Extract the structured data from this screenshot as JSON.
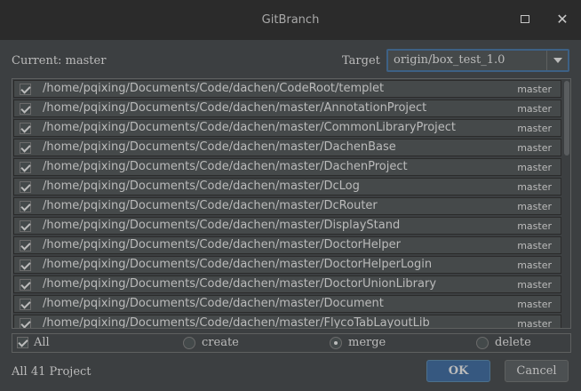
{
  "window": {
    "title": "GitBranch"
  },
  "header": {
    "current_label": "Current: master",
    "target_label": "Target",
    "target_value": "origin/box_test_1.0"
  },
  "projects": [
    {
      "path": "/home/pqixing/Documents/Code/dachen/CodeRoot/templet",
      "branch": "master",
      "checked": true
    },
    {
      "path": "/home/pqixing/Documents/Code/dachen/master/AnnotationProject",
      "branch": "master",
      "checked": true
    },
    {
      "path": "/home/pqixing/Documents/Code/dachen/master/CommonLibraryProject",
      "branch": "master",
      "checked": true
    },
    {
      "path": "/home/pqixing/Documents/Code/dachen/master/DachenBase",
      "branch": "master",
      "checked": true
    },
    {
      "path": "/home/pqixing/Documents/Code/dachen/master/DachenProject",
      "branch": "master",
      "checked": true
    },
    {
      "path": "/home/pqixing/Documents/Code/dachen/master/DcLog",
      "branch": "master",
      "checked": true
    },
    {
      "path": "/home/pqixing/Documents/Code/dachen/master/DcRouter",
      "branch": "master",
      "checked": true
    },
    {
      "path": "/home/pqixing/Documents/Code/dachen/master/DisplayStand",
      "branch": "master",
      "checked": true
    },
    {
      "path": "/home/pqixing/Documents/Code/dachen/master/DoctorHelper",
      "branch": "master",
      "checked": true
    },
    {
      "path": "/home/pqixing/Documents/Code/dachen/master/DoctorHelperLogin",
      "branch": "master",
      "checked": true
    },
    {
      "path": "/home/pqixing/Documents/Code/dachen/master/DoctorUnionLibrary",
      "branch": "master",
      "checked": true
    },
    {
      "path": "/home/pqixing/Documents/Code/dachen/master/Document",
      "branch": "master",
      "checked": true
    },
    {
      "path": "/home/pqixing/Documents/Code/dachen/master/FlycoTabLayoutLib",
      "branch": "master",
      "checked": true
    }
  ],
  "options": {
    "all_label": "All",
    "all_checked": true,
    "create_label": "create",
    "merge_label": "merge",
    "delete_label": "delete",
    "selected_action": "merge"
  },
  "footer": {
    "count_label": "All 41 Project",
    "ok_label": "OK",
    "cancel_label": "Cancel"
  },
  "colors": {
    "background": "#3c3f41",
    "titlebar": "#2b2b2b",
    "row": "#45494a",
    "accent": "#365880",
    "text": "#bbbbbb"
  },
  "icons": {
    "maximize": "maximize-icon",
    "close": "close-icon",
    "dropdown": "chevron-down-icon",
    "checkbox": "checkmark-icon"
  }
}
